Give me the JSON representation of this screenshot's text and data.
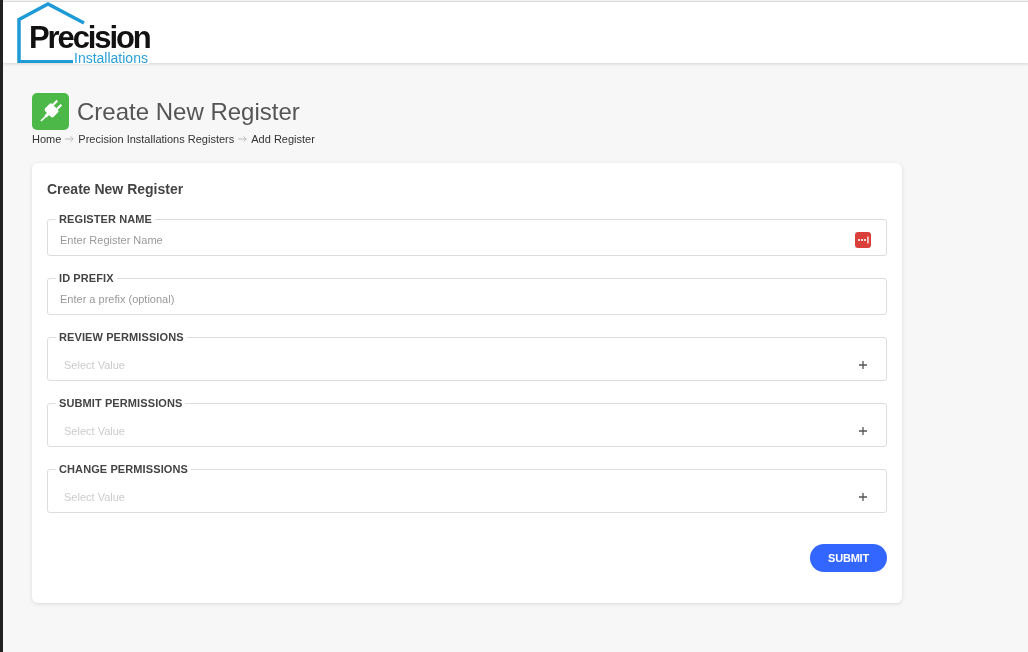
{
  "header": {
    "logo": {
      "title": "Precision",
      "subtitle": "Installations"
    }
  },
  "page": {
    "title": "Create New Register",
    "breadcrumb": [
      "Home",
      "Precision Installations Registers",
      "Add Register"
    ]
  },
  "form": {
    "title": "Create New Register",
    "fields": [
      {
        "kind": "text",
        "label": "REGISTER NAME",
        "placeholder": "Enter Register Name",
        "autofill_icon": true
      },
      {
        "kind": "text",
        "label": "ID PREFIX",
        "placeholder": "Enter a prefix (optional)",
        "autofill_icon": false
      },
      {
        "kind": "select",
        "label": "REVIEW PERMISSIONS",
        "placeholder": "Select Value"
      },
      {
        "kind": "select",
        "label": "SUBMIT PERMISSIONS",
        "placeholder": "Select Value"
      },
      {
        "kind": "select",
        "label": "CHANGE PERMISSIONS",
        "placeholder": "Select Value"
      }
    ],
    "submit": "SUBMIT"
  }
}
